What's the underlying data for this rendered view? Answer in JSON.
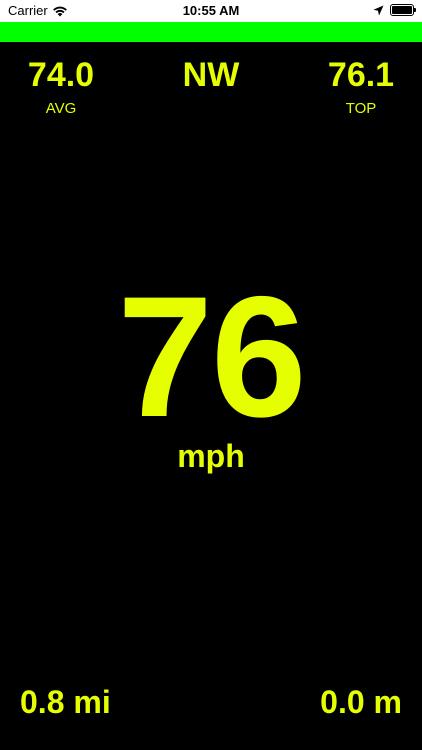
{
  "colors": {
    "accent": "#e6ff00",
    "signal": "#00ff00",
    "background": "#000000",
    "status_bar": "#ffffff"
  },
  "status_bar": {
    "carrier": "Carrier",
    "time": "10:55 AM",
    "icons": [
      "wifi-icon",
      "location-arrow-icon",
      "battery-icon"
    ]
  },
  "stats": {
    "avg_value": "74.0",
    "avg_label": "AVG",
    "direction": "NW",
    "top_value": "76.1",
    "top_label": "TOP"
  },
  "speed": {
    "value": "76",
    "unit": "mph"
  },
  "bottom": {
    "distance": "0.8 mi",
    "altitude": "0.0 m"
  }
}
